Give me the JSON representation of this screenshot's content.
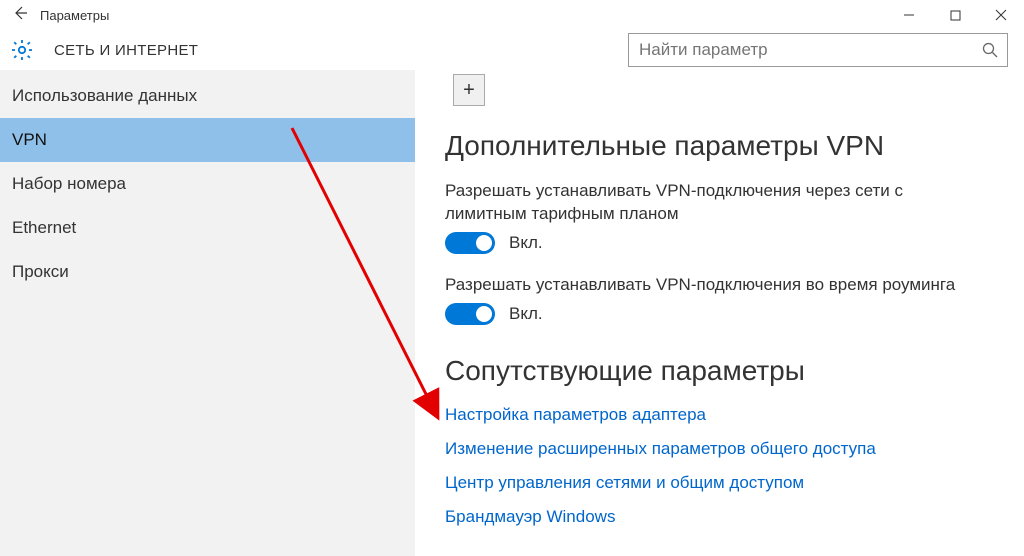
{
  "window": {
    "title": "Параметры"
  },
  "header": {
    "section": "СЕТЬ И ИНТЕРНЕТ",
    "search_placeholder": "Найти параметр"
  },
  "sidebar": {
    "items": [
      {
        "label": "Использование данных",
        "selected": false
      },
      {
        "label": "VPN",
        "selected": true
      },
      {
        "label": "Набор номера",
        "selected": false
      },
      {
        "label": "Ethernet",
        "selected": false
      },
      {
        "label": "Прокси",
        "selected": false
      }
    ]
  },
  "main": {
    "heading_advanced": "Дополнительные параметры VPN",
    "setting1": {
      "label": "Разрешать устанавливать VPN-подключения через сети с лимитным тарифным планом",
      "state": "Вкл."
    },
    "setting2": {
      "label": "Разрешать устанавливать VPN-подключения во время роуминга",
      "state": "Вкл."
    },
    "heading_related": "Сопутствующие параметры",
    "links": [
      "Настройка параметров адаптера",
      "Изменение расширенных параметров общего доступа",
      "Центр управления сетями и общим доступом",
      "Брандмауэр Windows"
    ]
  }
}
